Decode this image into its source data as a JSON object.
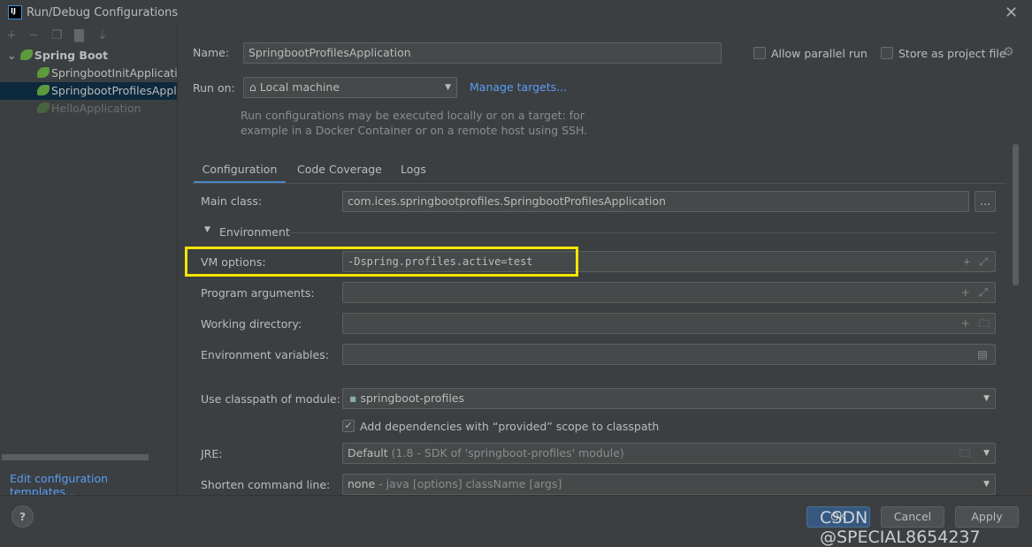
{
  "window": {
    "title": "Run/Debug Configurations",
    "logo": "IJ"
  },
  "tree": {
    "group": "Spring Boot",
    "items": [
      "SpringbootInitApplication",
      "SpringbootProfilesApplication",
      "HelloApplication"
    ],
    "selected": 1
  },
  "sidebar": {
    "edit_templates": "Edit configuration templates..."
  },
  "form": {
    "name_label": "Name:",
    "name_value": "SpringbootProfilesApplication",
    "allow_parallel": "Allow parallel run",
    "store_project": "Store as project file",
    "run_on_label": "Run on:",
    "run_on_value": "Local machine",
    "manage_targets": "Manage targets...",
    "run_hint_1": "Run configurations may be executed locally or on a target: for",
    "run_hint_2": "example in a Docker Container or on a remote host using SSH.",
    "tabs": [
      "Configuration",
      "Code Coverage",
      "Logs"
    ],
    "main_class_label": "Main class:",
    "main_class_value": "com.ices.springbootprofiles.SpringbootProfilesApplication",
    "environment": "Environment",
    "vm_label": "VM options:",
    "vm_value": "-Dspring.profiles.active=test",
    "program_args_label": "Program arguments:",
    "working_dir_label": "Working directory:",
    "env_vars_label": "Environment variables:",
    "classpath_label": "Use classpath of module:",
    "classpath_value": "springboot-profiles",
    "add_deps": "Add dependencies with “provided” scope to classpath",
    "jre_label": "JRE:",
    "jre_value": "Default",
    "jre_hint": "(1.8 - SDK of 'springboot-profiles' module)",
    "shorten_label": "Shorten command line:",
    "shorten_value": "none",
    "shorten_hint": "- java [options] className [args]"
  },
  "buttons": {
    "ok": "OK",
    "cancel": "Cancel",
    "apply": "Apply",
    "help": "?"
  },
  "watermark": "CSDN @SPECIAL8654237",
  "colors": {
    "highlight": "#f5e600",
    "selection": "#0d293e",
    "link": "#589df6"
  }
}
